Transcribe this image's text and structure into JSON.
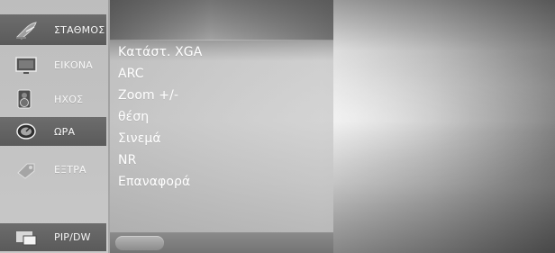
{
  "left_menu": {
    "items": [
      {
        "id": "station",
        "label": "ΣΤΑΘΜΟΣ",
        "icon": "satellite-dish-icon",
        "active": true
      },
      {
        "id": "picture",
        "label": "ΕΙΚΟΝΑ",
        "icon": "monitor-icon",
        "active": false
      },
      {
        "id": "sound",
        "label": "ΗΧΟΣ",
        "icon": "speaker-icon",
        "active": false
      },
      {
        "id": "time",
        "label": "ΩΡΑ",
        "icon": "clock-icon",
        "active": true
      },
      {
        "id": "extra",
        "label": "ΕΞΤΡΑ",
        "icon": "tag-icon",
        "active": false
      },
      {
        "id": "pip",
        "label": "PIP/DW",
        "icon": "pip-icon",
        "active": true
      }
    ]
  },
  "submenu": {
    "items": [
      "Κατάστ. XGA",
      "ARC",
      "Zoom +/-",
      "θέση",
      "Σινεμά",
      "NR",
      "Επαναφορά"
    ]
  },
  "colors": {
    "menu_active": "#5a5a5a",
    "menu_background": "#c4c4c4",
    "submenu_text": "#ffffff"
  }
}
